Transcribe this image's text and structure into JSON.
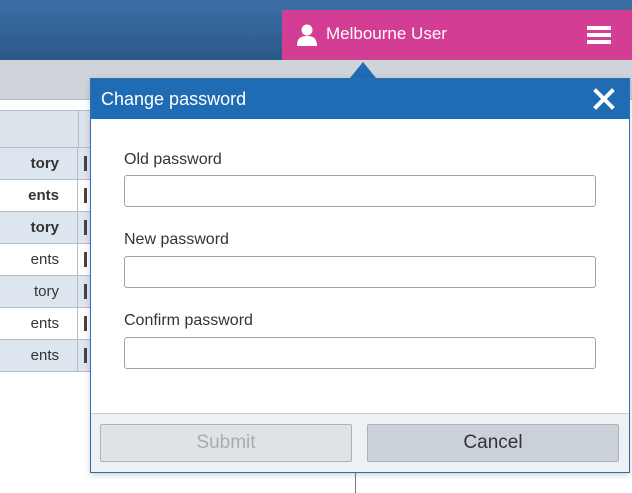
{
  "header": {
    "user_name": "Melbourne User",
    "user_icon": "user-icon",
    "menu_icon": "hamburger-menu-icon",
    "accent_color": "#d33d93",
    "bar_color": "#2a5889"
  },
  "background_table": {
    "rows": [
      {
        "text": "tory",
        "bold": true
      },
      {
        "text": "ents",
        "bold": true
      },
      {
        "text": "tory",
        "bold": true
      },
      {
        "text": "ents",
        "bold": false
      },
      {
        "text": "tory",
        "bold": false
      },
      {
        "text": "ents",
        "bold": false
      },
      {
        "text": "ents",
        "bold": false
      }
    ]
  },
  "dialog": {
    "title": "Change password",
    "close_icon": "close-icon",
    "header_color": "#1f6cb5",
    "fields": [
      {
        "label": "Old password",
        "value": "",
        "placeholder": ""
      },
      {
        "label": "New password",
        "value": "",
        "placeholder": ""
      },
      {
        "label": "Confirm password",
        "value": "",
        "placeholder": ""
      }
    ],
    "buttons": {
      "submit_label": "Submit",
      "cancel_label": "Cancel"
    }
  }
}
